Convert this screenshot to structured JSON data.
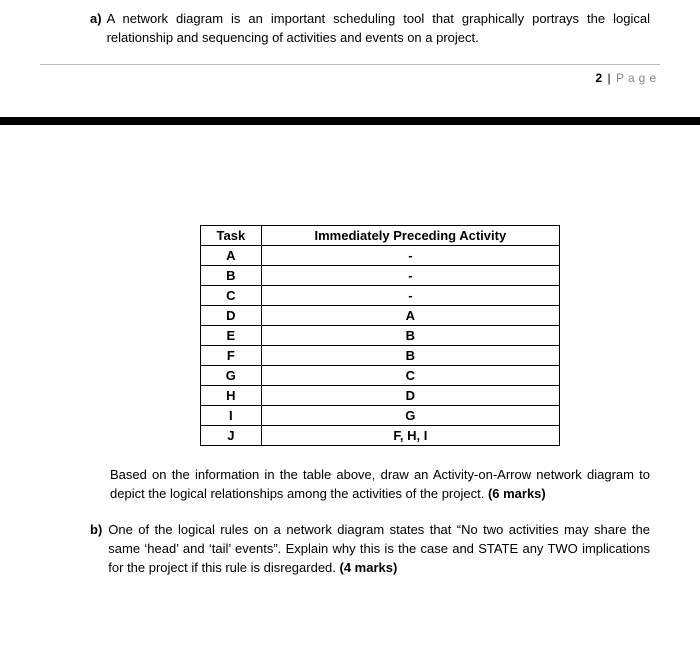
{
  "top": {
    "item_a_label": "a)",
    "item_a_text": "A network diagram is an important scheduling tool that graphically portrays the logical relationship and sequencing of activities and events on a project."
  },
  "pagenum": {
    "num": "2",
    "sep": "|",
    "word": "Page"
  },
  "table": {
    "headers": {
      "task": "Task",
      "preceding": "Immediately Preceding Activity"
    },
    "rows": [
      {
        "task": "A",
        "preceding": "-"
      },
      {
        "task": "B",
        "preceding": "-"
      },
      {
        "task": "C",
        "preceding": "-"
      },
      {
        "task": "D",
        "preceding": "A"
      },
      {
        "task": "E",
        "preceding": "B"
      },
      {
        "task": "F",
        "preceding": "B"
      },
      {
        "task": "G",
        "preceding": "C"
      },
      {
        "task": "H",
        "preceding": "D"
      },
      {
        "task": "I",
        "preceding": "G"
      },
      {
        "task": "J",
        "preceding": "F, H, I"
      }
    ]
  },
  "based_para_pre": "Based on the information in the table above, draw an Activity-on-Arrow network diagram to depict the logical relationships among the activities of the project. ",
  "based_para_bold": "(6 marks)",
  "item_b_label": "b)",
  "item_b_text_pre": "One of the logical rules on a network diagram states that “No two activities may share the same ‘head’ and ‘tail’ events”. Explain why this is the case and STATE any TWO implications for the project if this rule is disregarded. ",
  "item_b_text_bold": "(4 marks)"
}
